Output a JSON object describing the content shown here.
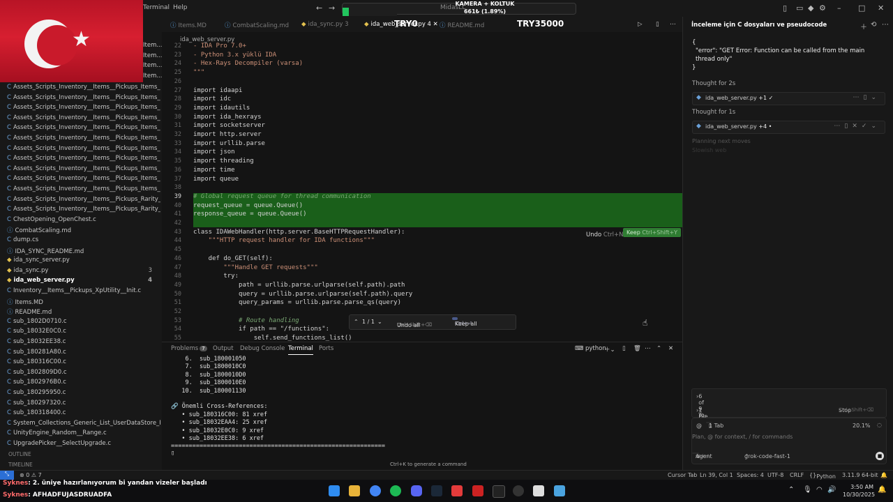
{
  "titlebar": {
    "menu_terminal": "Terminal",
    "menu_help": "Help",
    "search_text": "MidasLL",
    "overlay_line1": "KAMERA + KOLTUK",
    "overlay_line2": "661₺ (1.89%)",
    "progress_fraction": 0.0189
  },
  "tabs": {
    "items": [
      {
        "label": "Items.MD"
      },
      {
        "label": "CombatScaling.md"
      },
      {
        "label": "ida_sync.py 3"
      },
      {
        "label": "ida_web_server.py 4"
      },
      {
        "label": "README.md"
      }
    ],
    "overlay_try0": "TRY0",
    "overlay_try35000": "TRY35000"
  },
  "breadcrumb": "ida_web_server.py",
  "editor": {
    "lines": [
      {
        "n": "22",
        "t": "- IDA Pro 7.0+"
      },
      {
        "n": "23",
        "t": "- Python 3.x yüklü IDA"
      },
      {
        "n": "24",
        "t": "- Hex-Rays Decompiler (varsa)"
      },
      {
        "n": "25",
        "t": "\"\"\""
      },
      {
        "n": "26",
        "t": ""
      },
      {
        "n": "27",
        "t": "import idaapi"
      },
      {
        "n": "28",
        "t": "import idc"
      },
      {
        "n": "29",
        "t": "import idautils"
      },
      {
        "n": "30",
        "t": "import ida_hexrays"
      },
      {
        "n": "31",
        "t": "import socketserver"
      },
      {
        "n": "32",
        "t": "import http.server"
      },
      {
        "n": "33",
        "t": "import urllib.parse"
      },
      {
        "n": "34",
        "t": "import json"
      },
      {
        "n": "35",
        "t": "import threading"
      },
      {
        "n": "36",
        "t": "import time"
      },
      {
        "n": "37",
        "t": "import queue"
      },
      {
        "n": "38",
        "t": ""
      },
      {
        "n": "39",
        "t": "# Global request queue for thread communication"
      },
      {
        "n": "40",
        "t": "request_queue = queue.Queue()"
      },
      {
        "n": "41",
        "t": "response_queue = queue.Queue()"
      },
      {
        "n": "42",
        "t": ""
      },
      {
        "n": "43",
        "t": "class IDAWebHandler(http.server.BaseHTTPRequestHandler):"
      },
      {
        "n": "44",
        "t": "    \"\"\"HTTP request handler for IDA functions\"\"\""
      },
      {
        "n": "45",
        "t": ""
      },
      {
        "n": "46",
        "t": "    def do_GET(self):"
      },
      {
        "n": "47",
        "t": "        \"\"\"Handle GET requests\"\"\""
      },
      {
        "n": "48",
        "t": "        try:"
      },
      {
        "n": "49",
        "t": "            path = urllib.parse.urlparse(self.path).path"
      },
      {
        "n": "50",
        "t": "            query = urllib.parse.urlparse(self.path).query"
      },
      {
        "n": "51",
        "t": "            query_params = urllib.parse.parse_qs(query)"
      },
      {
        "n": "52",
        "t": ""
      },
      {
        "n": "53",
        "t": "            # Route handling"
      },
      {
        "n": "54",
        "t": "            if path == \"/functions\":"
      },
      {
        "n": "55",
        "t": "                self.send_functions_list()"
      }
    ],
    "undo_label": "Undo",
    "undo_shortcut": "Ctrl+N",
    "keep_label": "Keep",
    "keep_shortcut": "Ctrl+Shift+Y",
    "diff_counter": "1 / 1",
    "undo_all_label": "Undo all",
    "undo_all_shortcut": "Ctrl+Shift+⌫",
    "keep_all_label": "Keep all",
    "keep_all_shortcut": "Ctrl+⏎"
  },
  "sidebar": {
    "files": [
      {
        "label": "Assets_Scripts_Inventory__Items__Pickups_Items_Item..."
      },
      {
        "label": "Assets_Scripts_Inventory__Items__Pickups_Items_Item..."
      },
      {
        "label": "Assets_Scripts_Inventory__Items__Pickups_Items_Item..."
      },
      {
        "label": "Assets_Scripts_Inventory__Items__Pickups_Items_Item..."
      },
      {
        "label": "Assets_Scripts_Inventory__Items__Pickups_Items_Item..."
      },
      {
        "label": "Assets_Scripts_Inventory__Items__Pickups_Items_Item..."
      },
      {
        "label": "Assets_Scripts_Inventory__Items__Pickups_Items_Item..."
      },
      {
        "label": "Assets_Scripts_Inventory__Items__Pickups_Items_Item..."
      },
      {
        "label": "Assets_Scripts_Inventory__Items__Pickups_Items_Item..."
      },
      {
        "label": "Assets_Scripts_Inventory__Items__Pickups_Items_Item..."
      },
      {
        "label": "Assets_Scripts_Inventory__Items__Pickups_Items_Item..."
      },
      {
        "label": "Assets_Scripts_Inventory__Items__Pickups_Rarity__Cal..."
      },
      {
        "label": "Assets_Scripts_Inventory__Items__Pickups_Rarity__Ge..."
      },
      {
        "label": "ChestOpening_OpenChest.c"
      },
      {
        "label": "CombatScaling.md"
      },
      {
        "label": "dump.cs"
      },
      {
        "label": "IDA_SYNC_README.md"
      },
      {
        "label": "ida_sync_server.py"
      },
      {
        "label": "ida_sync.py",
        "count": "3"
      },
      {
        "label": "ida_web_server.py",
        "count": "4"
      },
      {
        "label": "Inventory__Items__Pickups_XpUtility__Init.c"
      },
      {
        "label": "Items.MD"
      },
      {
        "label": "README.md"
      },
      {
        "label": "sub_1802D0710.c"
      },
      {
        "label": "sub_18032E0C0.c"
      },
      {
        "label": "sub_18032EE38.c"
      },
      {
        "label": "sub_180281A80.c"
      },
      {
        "label": "sub_180316C00.c"
      },
      {
        "label": "sub_1802809D0.c"
      },
      {
        "label": "sub_1802976B0.c"
      },
      {
        "label": "sub_180295950.c"
      },
      {
        "label": "sub_180297320.c"
      },
      {
        "label": "sub_180318400.c"
      },
      {
        "label": "System_Collections_Generic_List_UserDataStore_Play..."
      },
      {
        "label": "UnityEngine_Random__Range.c"
      },
      {
        "label": "UpgradePicker__SelectUpgrade.c"
      }
    ],
    "outline_label": "OUTLINE",
    "timeline_label": "TIMELINE",
    "partial_items": [
      "Item...",
      "Item...",
      "Item...",
      "Item..."
    ]
  },
  "panel": {
    "tabs": [
      "Problems",
      "Output",
      "Debug Console",
      "Terminal",
      "Ports"
    ],
    "problems_badge": "7",
    "shell_label": "python",
    "terminal_lines": [
      "    6.  sub_180001050",
      "    7.  sub_1800010C0",
      "    8.  sub_1800010D0",
      "    9.  sub_1800010E0",
      "   10.  sub_180001130",
      "",
      "🔗 Önemli Cross-References:",
      "   • sub_180316C00: 81 xref",
      "   • sub_18032EAA4: 25 xref",
      "   • sub_18032E0C0: 9 xref",
      "   • sub_18032EE38: 6 xref",
      "============================================================"
    ],
    "prompt": "▯",
    "hint": "Ctrl+K to generate a command"
  },
  "chat": {
    "title": "İnceleme için C dosyaları ve pseudocode",
    "error_open": "{",
    "error_text": "\"error\": \"GET Error: Function can be called from the main thread only\"",
    "error_close": "}",
    "thought1": "Thought for 2s",
    "file1": "ida_web_server.py",
    "file1_delta": "+1 ✓",
    "thought2": "Thought for 1s",
    "file2": "ida_web_server.py",
    "file2_delta": "+4 •",
    "planning": "Planning next moves",
    "slowish": "Slowish web",
    "todos": "6 of 9 To-dos",
    "files_label": "1 File",
    "stop_label": "Stop",
    "stop_shortcut": "Ctrl+Shift+⌫",
    "tab_chip": "1 Tab",
    "percent": "20.1%",
    "placeholder": "Plan, @ for context, / for commands",
    "agent_label": "Agent",
    "agent_shortcut": "Ctrl+I",
    "model": "grok-code-fast-1"
  },
  "statusbar": {
    "problems": "⊗ 0 ⚠ 7",
    "cursor_tab": "Cursor Tab",
    "position": "Ln 39, Col 1",
    "spaces": "Spaces: 4",
    "encoding": "UTF-8",
    "eol": "CRLF",
    "language": "Python",
    "interpreter": "3.11.9 64-bit"
  },
  "stream_chat": [
    {
      "user": "Syknes",
      "msg": ": 2. üniye hazırlanıyorum bi yandan vizeler başladı"
    },
    {
      "user": "Syknes",
      "msg": ": AFHADFUJASDRUADFA"
    }
  ],
  "taskbar": {
    "time": "3:50 AM",
    "date": "10/30/2025"
  },
  "colors": {
    "accent_green": "#22c55e",
    "highlight_green": "#1a5f1a",
    "keep_button": "#2f7d32",
    "flag_red": "#d71f30"
  }
}
